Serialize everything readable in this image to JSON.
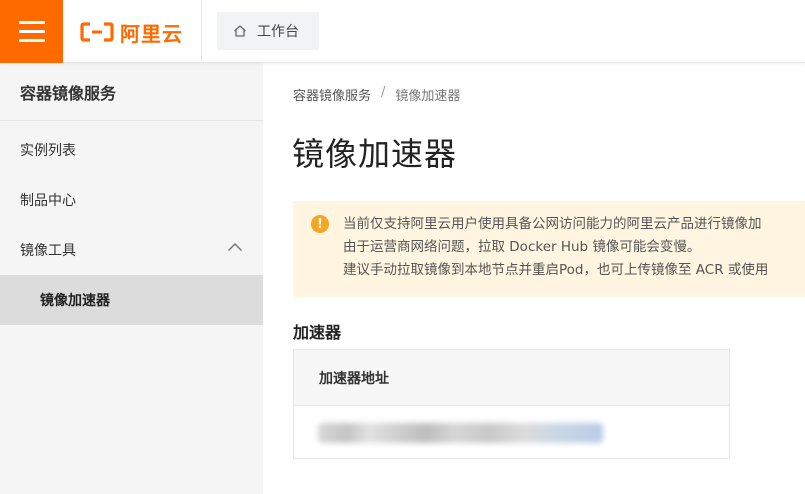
{
  "header": {
    "logo_text": "阿里云",
    "workbench_label": "工作台",
    "brand_color": "#ff6a00"
  },
  "sidebar": {
    "title": "容器镜像服务",
    "items": [
      {
        "label": "实例列表"
      },
      {
        "label": "制品中心"
      },
      {
        "label": "镜像工具",
        "expanded": true
      }
    ],
    "sub_items": [
      {
        "label": "镜像加速器",
        "active": true
      }
    ]
  },
  "main": {
    "breadcrumb": {
      "root": "容器镜像服务",
      "separator": "/",
      "current": "镜像加速器"
    },
    "page_title": "镜像加速器",
    "notice": {
      "icon": "warning-icon",
      "lines": [
        "当前仅支持阿里云用户使用具备公网访问能力的阿里云产品进行镜像加",
        "由于运营商网络问题，拉取 Docker Hub 镜像可能会变慢。",
        "建议手动拉取镜像到本地节点并重启Pod，也可上传镜像至 ACR 或使用"
      ]
    },
    "accelerator": {
      "section_title": "加速器",
      "column_header": "加速器地址"
    }
  }
}
